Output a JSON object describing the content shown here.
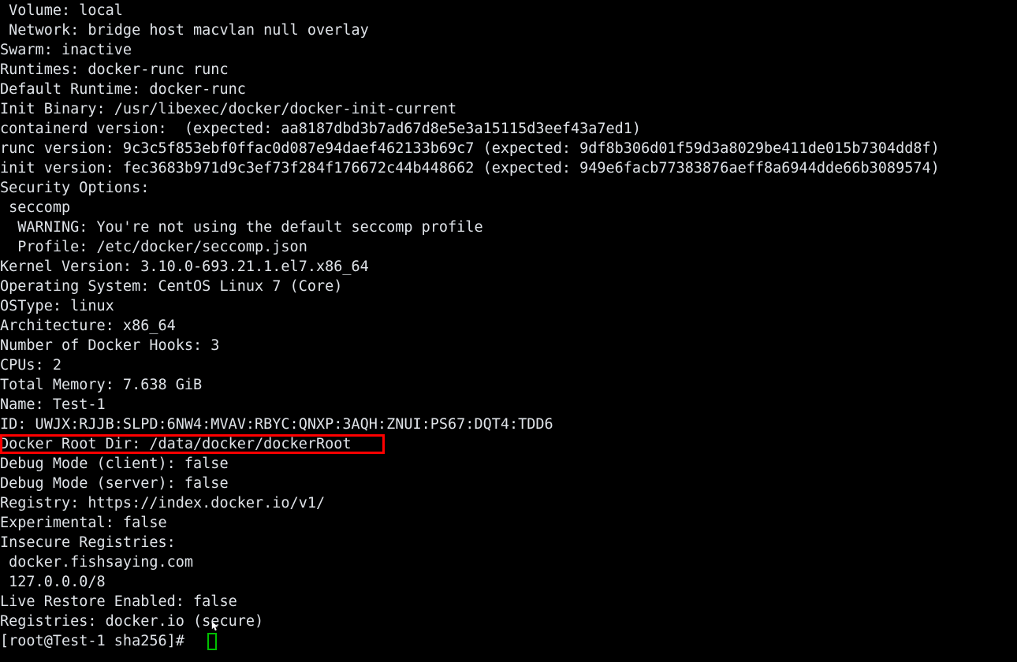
{
  "terminal": {
    "title": "docker info output",
    "background_color": "#000000",
    "text_color": "#dfe3e8",
    "highlight_color": "#ff0000",
    "cursor_color": "#00c000",
    "lines": [
      " Volume: local",
      " Network: bridge host macvlan null overlay",
      "Swarm: inactive",
      "Runtimes: docker-runc runc",
      "Default Runtime: docker-runc",
      "Init Binary: /usr/libexec/docker/docker-init-current",
      "containerd version:  (expected: aa8187dbd3b7ad67d8e5e3a15115d3eef43a7ed1)",
      "runc version: 9c3c5f853ebf0ffac0d087e94daef462133b69c7 (expected: 9df8b306d01f59d3a8029be411de015b7304dd8f)",
      "init version: fec3683b971d9c3ef73f284f176672c44b448662 (expected: 949e6facb77383876aeff8a6944dde66b3089574)",
      "Security Options:",
      " seccomp",
      "  WARNING: You're not using the default seccomp profile",
      "  Profile: /etc/docker/seccomp.json",
      "Kernel Version: 3.10.0-693.21.1.el7.x86_64",
      "Operating System: CentOS Linux 7 (Core)",
      "OSType: linux",
      "Architecture: x86_64",
      "Number of Docker Hooks: 3",
      "CPUs: 2",
      "Total Memory: 7.638 GiB",
      "Name: Test-1",
      "ID: UWJX:RJJB:SLPD:6NW4:MVAV:RBYC:QNXP:3AQH:ZNUI:PS67:DQT4:TDD6",
      "Docker Root Dir: /data/docker/dockerRoot",
      "Debug Mode (client): false",
      "Debug Mode (server): false",
      "Registry: https://index.docker.io/v1/",
      "Experimental: false",
      "Insecure Registries:",
      " docker.fishsaying.com",
      " 127.0.0.0/8",
      "Live Restore Enabled: false",
      "Registries: docker.io (secure)",
      "[root@Test-1 sha256]# "
    ],
    "prompt": "[root@Test-1 sha256]#",
    "highlighted_line": "Docker Root Dir: /data/docker/dockerRoot"
  }
}
